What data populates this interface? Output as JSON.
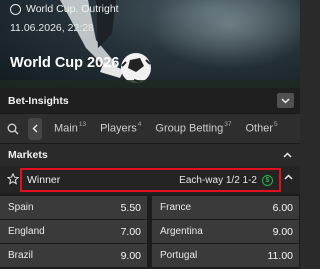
{
  "event": {
    "competition": "World Cup. Outright",
    "datetime": "11.06.2026, 22:28",
    "title": "World Cup 2026",
    "icon": "football-icon"
  },
  "insights": {
    "label": "Bet-Insights",
    "icon": "chevron-down-icon"
  },
  "tabs": [
    {
      "label": "Main",
      "count": "13"
    },
    {
      "label": "Players",
      "count": "4"
    },
    {
      "label": "Group Betting",
      "count": "37"
    },
    {
      "label": "Other",
      "count": "5"
    }
  ],
  "markets": {
    "label": "Markets",
    "winner": {
      "label": "Winner",
      "each_way": "Each-way 1/2 1-2",
      "each_way_icon": "$"
    },
    "selections": [
      {
        "team": "Spain",
        "price": "5.50"
      },
      {
        "team": "France",
        "price": "6.00"
      },
      {
        "team": "England",
        "price": "7.00"
      },
      {
        "team": "Argentina",
        "price": "9.00"
      },
      {
        "team": "Brazil",
        "price": "9.00"
      },
      {
        "team": "Portugal",
        "price": "11.00"
      }
    ]
  },
  "colors": {
    "highlight_border": "#e0101c",
    "each_way_green": "#28b24f",
    "cell_bg": "#3a3a3a"
  }
}
